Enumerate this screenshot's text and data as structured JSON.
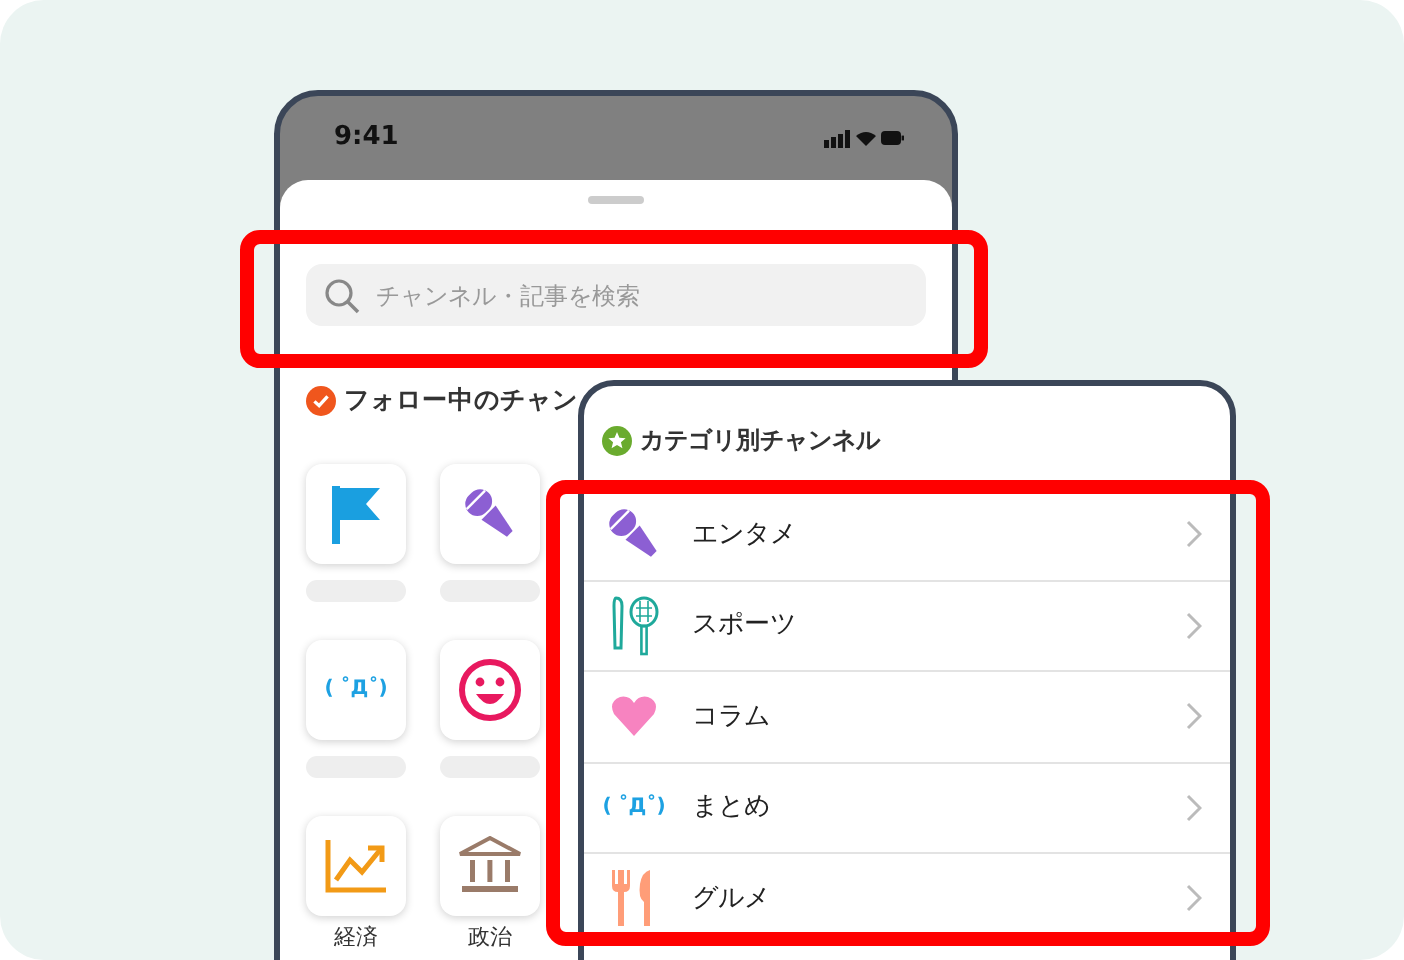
{
  "status_bar": {
    "time": "9:41"
  },
  "search": {
    "placeholder": "チャンネル・記事を検索",
    "highlighted": true
  },
  "followed": {
    "title": "フォロー中のチャン",
    "tiles": [
      {
        "kind": "flag"
      },
      {
        "kind": "mic"
      },
      {
        "kind": "kaomoji",
        "icon_text": "( ˚Д˚)"
      },
      {
        "kind": "smile"
      },
      {
        "kind": "chart",
        "label": "経済"
      },
      {
        "kind": "bank",
        "label": "政治"
      }
    ]
  },
  "categories": {
    "title": "カテゴリ別チャンネル",
    "highlighted": true,
    "items": [
      {
        "kind": "mic",
        "label": "エンタメ"
      },
      {
        "kind": "sports",
        "label": "スポーツ"
      },
      {
        "kind": "heart",
        "label": "コラム"
      },
      {
        "kind": "kaomoji",
        "icon_text": "( ˚Д˚)",
        "label": "まとめ"
      },
      {
        "kind": "cutlery",
        "label": "グルメ"
      }
    ]
  }
}
